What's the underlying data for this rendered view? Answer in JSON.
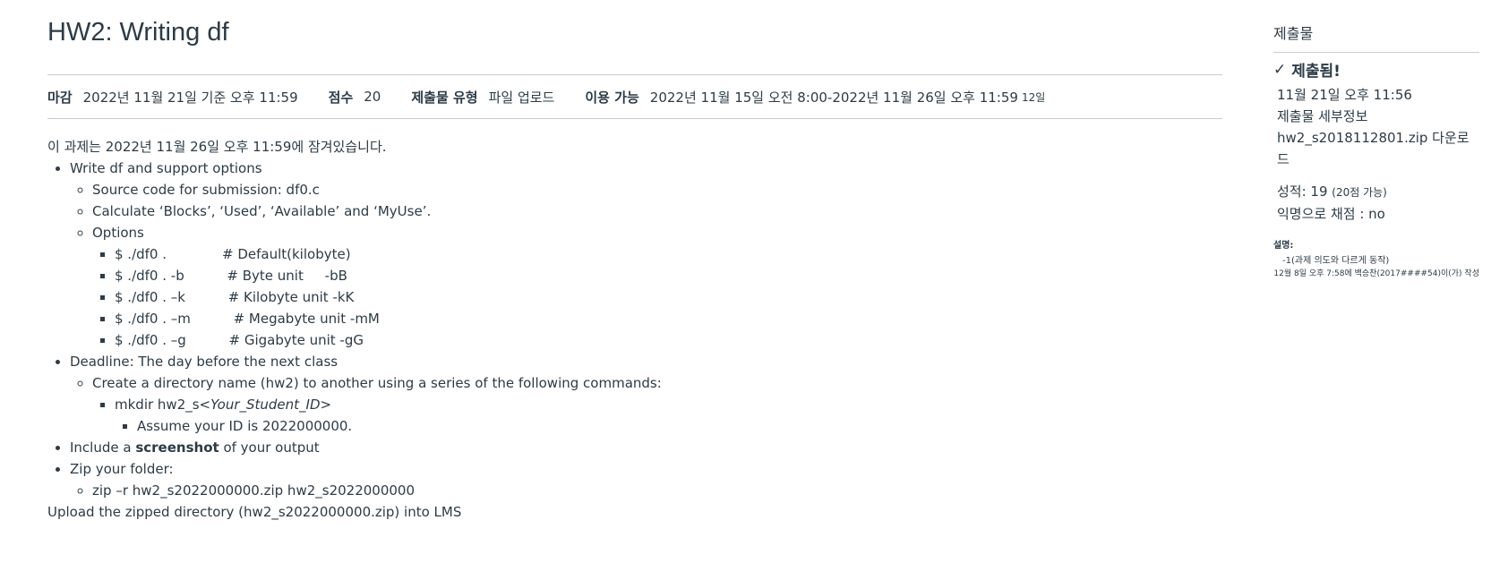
{
  "assignment": {
    "title": "HW2: Writing df",
    "meta": {
      "due_label": "마감",
      "due_value": "2022년 11월 21일 기준 오후 11:59",
      "points_label": "점수",
      "points_value": "20",
      "submission_type_label": "제출물 유형",
      "submission_type_value": "파일 업로드",
      "available_label": "이용 가능",
      "available_value": "2022년 11월 15일 오전 8:00-2022년 11월 26일 오후 11:59",
      "available_days": "12일"
    },
    "locked_notice": "이 과제는 2022년 11월 26일 오후 11:59에 잠겨있습니다.",
    "content": {
      "b1": "Write df and support options",
      "b1_source": "Source code for submission: df0.c",
      "b1_calc": "Calculate ‘Blocks’, ‘Used’, ‘Available’ and ‘MyUse’.",
      "b1_options": "Options",
      "options": [
        "$ ./df0 .             # Default(kilobyte)",
        "$ ./df0 . -b          # Byte unit     -bB",
        "$ ./df0 . –k          # Kilobyte unit -kK",
        "$ ./df0 . –m          # Megabyte unit -mM",
        "$ ./df0 . –g          # Gigabyte unit -gG"
      ],
      "b2": "Deadline: The day before the next class",
      "b2_create": "Create a directory name (hw2) to another using a series of the following commands:",
      "b2_mkdir_prefix": "mkdir hw2_s<",
      "b2_mkdir_italic": "Your_Student_ID",
      "b2_mkdir_suffix": ">",
      "b2_assume": "Assume your ID is 2022000000.",
      "b3_prefix": "Include a ",
      "b3_bold": "screenshot",
      "b3_suffix": " of your output",
      "b4": "Zip your folder:",
      "b4_cmd": "zip –r hw2_s2022000000.zip hw2_s2022000000",
      "upload": "Upload the zipped directory (hw2_s2022000000.zip) into LMS"
    }
  },
  "sidebar": {
    "title": "제출물",
    "status": "제출됨!",
    "submitted_at": "11월 21일 오후 11:56",
    "details_link": "제출물 세부정보",
    "download_link": "hw2_s2018112801.zip 다운로드",
    "grade_label": "성적: 19",
    "grade_possible": "(20점 가능)",
    "anonymous": "익명으로 채점 : no",
    "comment_label": "설명:",
    "comment_text": "-1(과제 의도와 다르게 동작)",
    "comment_meta": "12월 8일 오후 7:58에 백승찬(2017####54)이(가) 작성"
  },
  "icons": {
    "status": "check-icon"
  }
}
